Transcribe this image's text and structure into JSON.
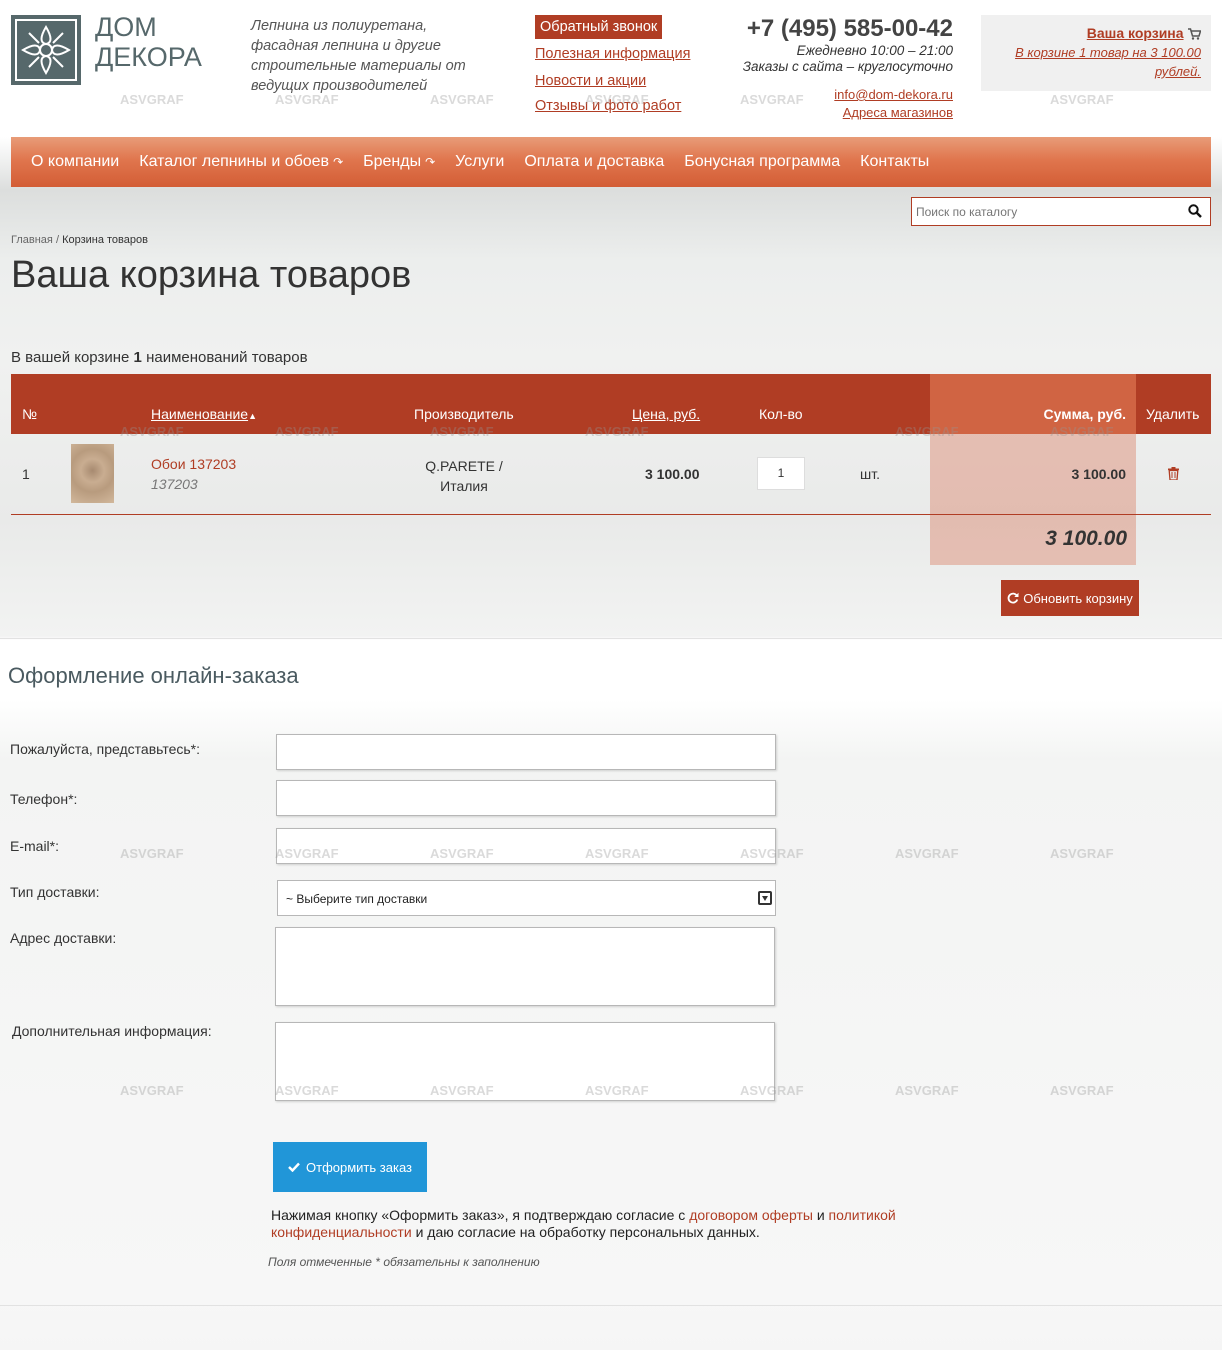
{
  "header": {
    "logo_text_line1": "ДОМ",
    "logo_text_line2": "ДЕКОРА",
    "tagline": "Лепнина из полиуретана, фасадная лепнина и другие строительные материалы от ведущих производителей",
    "callback_button": "Обратный звонок",
    "links": [
      "Полезная информация",
      "Новости и акции",
      "Отзывы и фото работ"
    ],
    "phone": "+7 (495) 585-00-42",
    "hours_line1": "Ежедневно 10:00 – 21:00",
    "hours_line2": "Заказы с сайта – круглосуточно",
    "email": "info@dom-dekora.ru",
    "stores_link": "Адреса магазинов",
    "cart": {
      "title": "Ваша корзина",
      "info": "В корзине 1 товар на 3 100.00 рублей."
    }
  },
  "watermark_text": "ASVGRAF",
  "nav": {
    "items": [
      {
        "label": "О компании",
        "dropdown": false
      },
      {
        "label": "Каталог лепнины и обоев",
        "dropdown": true
      },
      {
        "label": "Бренды",
        "dropdown": true
      },
      {
        "label": "Услуги",
        "dropdown": false
      },
      {
        "label": "Оплата и доставка",
        "dropdown": false
      },
      {
        "label": "Бонусная программа",
        "dropdown": false
      },
      {
        "label": "Контакты",
        "dropdown": false
      }
    ]
  },
  "search": {
    "placeholder": "Поиск по каталогу"
  },
  "breadcrumb": {
    "home": "Главная",
    "separator": "/",
    "current": "Корзина товаров"
  },
  "page_title": "Ваша корзина товаров",
  "cart_summary": {
    "prefix": "В вашей корзине",
    "count": "1",
    "suffix": "наименований товаров"
  },
  "table": {
    "headers": {
      "num": "№",
      "name": "Наименование",
      "manufacturer": "Производитель",
      "price": "Цена, руб.",
      "qty": "Кол-во",
      "sum": "Сумма, руб.",
      "delete": "Удалить"
    },
    "rows": [
      {
        "num": "1",
        "name": "Обои 137203",
        "sku": "137203",
        "manufacturer_line1": "Q.PARETE /",
        "manufacturer_line2": "Италия",
        "price": "3 100.00",
        "qty": "1",
        "unit": "шт.",
        "sum": "3 100.00"
      }
    ],
    "total": "3 100.00",
    "update_button": "Обновить корзину"
  },
  "order_form": {
    "title": "Оформление онлайн-заказа",
    "fields": {
      "name_label": "Пожалуйста, представьтесь*:",
      "phone_label": "Телефон*:",
      "email_label": "E-mail*:",
      "delivery_label": "Тип доставки:",
      "delivery_selected": "~ Выберите тип доставки",
      "address_label": "Адрес доставки:",
      "extra_label": "Дополнительная информация:"
    },
    "submit_button": "Отформить заказ",
    "consent_text_1": "Нажимая кнопку «Оформить заказ», я подтверждаю согласие с",
    "consent_link_1": "договором оферты",
    "consent_and": "и",
    "consent_link_2": "политикой конфиденциальности",
    "consent_text_2": "и даю согласие на обработку персональных данных.",
    "required_note": "Поля отмеченные * обязательны к заполнению"
  },
  "colors": {
    "accent": "#b03d24",
    "nav_gradient_top": "#e89c78",
    "nav_gradient_bottom": "#d35d35",
    "sum_column": "#d06443",
    "submit_button": "#2196d8",
    "logo": "#56686b"
  }
}
